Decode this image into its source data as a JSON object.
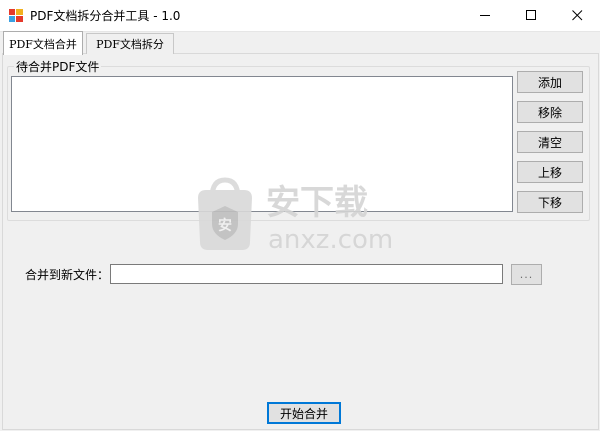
{
  "window": {
    "title": "PDF文档拆分合并工具 - 1.0"
  },
  "tabs": [
    {
      "label": "PDF文档合并",
      "active": true
    },
    {
      "label": "PDF文档拆分",
      "active": false
    }
  ],
  "merge_panel": {
    "group_label": "待合并PDF文件",
    "file_list": [],
    "buttons": {
      "add": "添加",
      "remove": "移除",
      "clear": "清空",
      "move_up": "上移",
      "move_down": "下移"
    },
    "output_label": "合并到新文件：",
    "output_value": "",
    "browse_label": "...",
    "start_label": "开始合并"
  },
  "watermark": {
    "text": "anxz.com"
  },
  "colors": {
    "accent": "#0078d7",
    "button_face": "#e1e1e1",
    "window_bg": "#f0f0f0"
  }
}
